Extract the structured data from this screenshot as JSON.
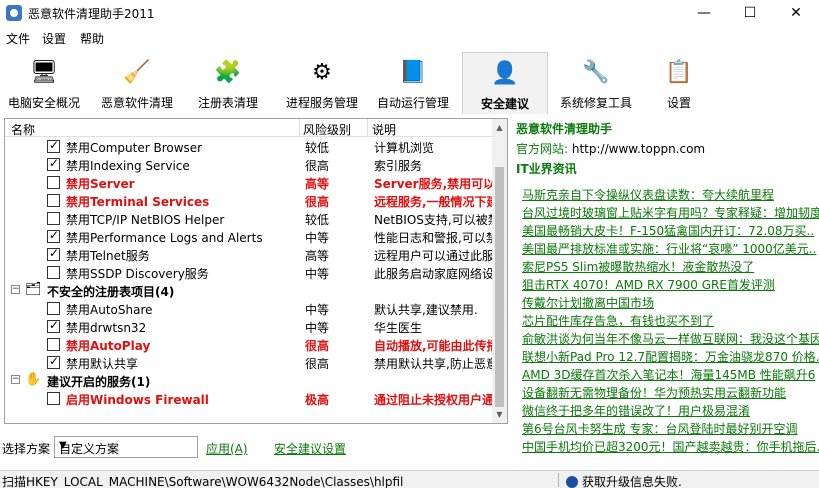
{
  "window": {
    "title": "恶意软件清理助手2011",
    "min_glyph": "—",
    "max_glyph": "☐",
    "close_glyph": "✕"
  },
  "menu": [
    "文件",
    "设置",
    "帮助"
  ],
  "toolbar": {
    "tabs": [
      {
        "label": "电脑安全概况",
        "icon": "computer-info-icon",
        "glyph": "🖥"
      },
      {
        "label": "恶意软件清理",
        "icon": "broom-clean-icon",
        "glyph": "🧹"
      },
      {
        "label": "注册表清理",
        "icon": "registry-icon",
        "glyph": "🧩"
      },
      {
        "label": "进程服务管理",
        "icon": "gears-icon",
        "glyph": "⚙"
      },
      {
        "label": "自动运行管理",
        "icon": "startup-icon",
        "glyph": "📘"
      },
      {
        "label": "安全建议",
        "icon": "security-user-icon",
        "glyph": "👤",
        "active": true
      },
      {
        "label": "系统修复工具",
        "icon": "repair-tools-icon",
        "glyph": "🔧"
      },
      {
        "label": "设置",
        "icon": "settings-checklist-icon",
        "glyph": "📋"
      }
    ]
  },
  "list": {
    "headers": {
      "name": "名称",
      "risk": "风险级别",
      "desc": "说明"
    },
    "rows": [
      {
        "type": "item",
        "checked": true,
        "name": "禁用Computer Browser",
        "risk": "较低",
        "desc": "计算机浏览"
      },
      {
        "type": "item",
        "checked": true,
        "name": "禁用Indexing Service",
        "risk": "很高",
        "desc": "索引服务"
      },
      {
        "type": "item",
        "checked": false,
        "red": true,
        "name": "禁用Server",
        "risk": "高等",
        "desc": "Server服务,禁用可以禁"
      },
      {
        "type": "item",
        "checked": false,
        "red": true,
        "name": "禁用Terminal Services",
        "risk": "很高",
        "desc": "远程服务,一般情况下建"
      },
      {
        "type": "item",
        "checked": false,
        "name": "禁用TCP/IP NetBIOS Helper",
        "risk": "较低",
        "desc": "NetBIOS支持,可以被禁"
      },
      {
        "type": "item",
        "checked": true,
        "name": "禁用Performance Logs and Alerts",
        "risk": "中等",
        "desc": "性能日志和警报,可以禁"
      },
      {
        "type": "item",
        "checked": true,
        "name": "禁用Telnet服务",
        "risk": "高等",
        "desc": "远程用户可以通过此服务"
      },
      {
        "type": "item",
        "checked": false,
        "name": "禁用SSDP Discovery服务",
        "risk": "中等",
        "desc": "此服务启动家庭网络设备"
      },
      {
        "type": "group",
        "name": "不安全的注册表项目(4)",
        "icon": "registry-group-icon",
        "glyph": "🗂"
      },
      {
        "type": "item",
        "checked": false,
        "name": "禁用AutoShare",
        "risk": "中等",
        "desc": "默认共享,建议禁用."
      },
      {
        "type": "item",
        "checked": true,
        "name": "禁用drwtsn32",
        "risk": "中等",
        "desc": "华生医生"
      },
      {
        "type": "item",
        "checked": false,
        "red": true,
        "name": "禁用AutoPlay",
        "risk": "很高",
        "desc": "自动播放,可能由此传播"
      },
      {
        "type": "item",
        "checked": true,
        "name": "禁用默认共享",
        "risk": "很高",
        "desc": "禁用默认共享,防止恶意"
      },
      {
        "type": "group",
        "name": "建议开启的服务(1)",
        "icon": "hand-service-icon",
        "glyph": "✋"
      },
      {
        "type": "item",
        "checked": false,
        "red": true,
        "name": "启用Windows Firewall",
        "risk": "极高",
        "desc": "通过阻止未授权用户通过"
      }
    ]
  },
  "scheme": {
    "label": "选择方案",
    "selected": "自定义方案",
    "apply": "应用(A)",
    "settings": "安全建议设置"
  },
  "right_panel": {
    "title": "恶意软件清理助手",
    "site_key": "官方网站:",
    "site_url": "http://www.toppn.com",
    "news_title": "IT业界资讯",
    "news": [
      "马斯克亲自下令操纵仪表盘读数：夸大续航里程",
      "台风过境时玻璃窗上贴米字有用吗？专家释疑：增加韧度",
      "美国最畅销大皮卡！F-150猛禽国内开订：72.08万买..",
      "美国最严排放标准或实施：行业将“哀嚎” 1000亿美元..",
      "索尼PS5 Slim被曝散热缩水！液金散热没了",
      "狙击RTX 4070！AMD RX 7900 GRE首发评测",
      "传戴尔计划撤离中国市场",
      "芯片配件库存告急，有钱也买不到了",
      "俞敏洪谈为何当年不像马云一样做互联网：我没这个基因",
      "联想小新Pad Pro 12.7配置揭晓：万金油骁龙870 价格..",
      "AMD 3D缓存首次杀入笔记本！海量145MB 性能飙升6",
      "设备翻新无需物理备份！华为预热实用云翻新功能",
      "微信终于把多年的错误改了！用户极易混淆",
      "第6号台风卡努生成 专家：台风登陆时最好别开空调",
      "中国手机均价已超3200元！国产越卖越贵：你手机拖后.."
    ]
  },
  "status": {
    "left": "扫描HKEY_LOCAL_MACHINE\\Software\\WOW6432Node\\Classes\\hlpfil",
    "right": "获取升级信息失败."
  }
}
